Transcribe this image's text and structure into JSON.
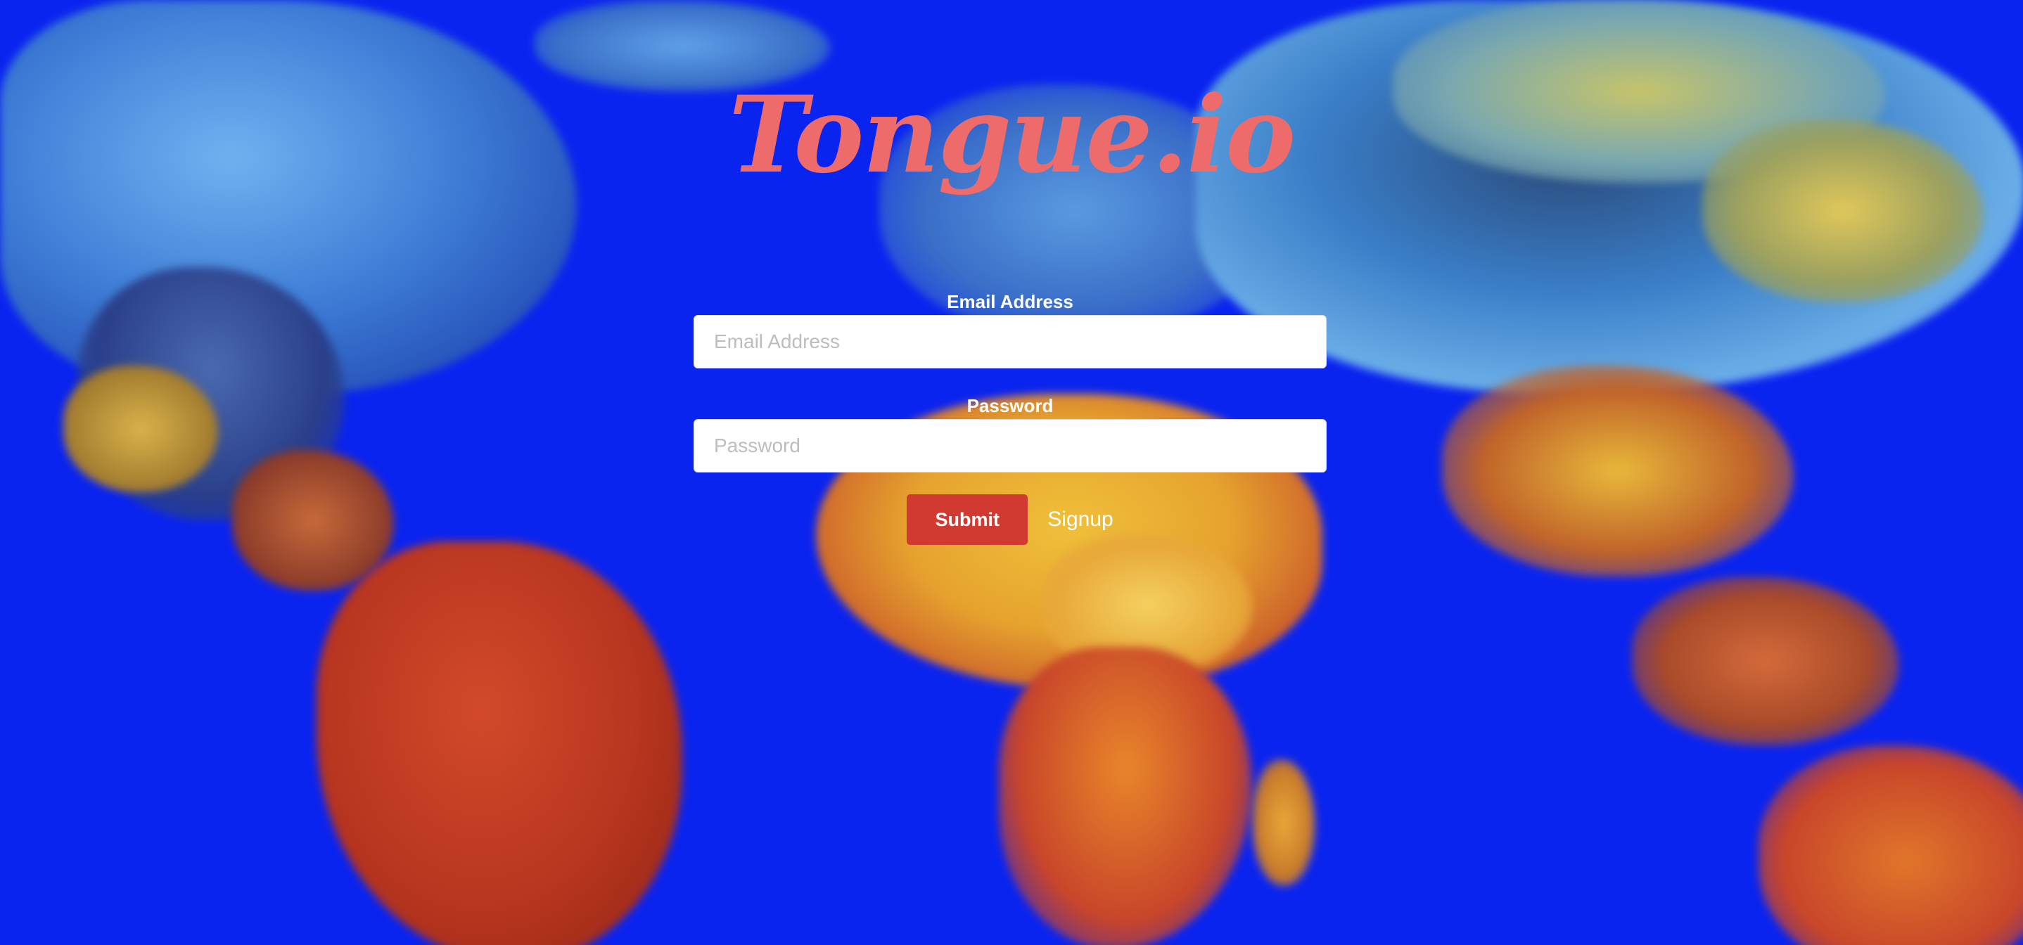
{
  "brand": {
    "logo_text": "Tongue.io",
    "logo_color": "#ee6b6b"
  },
  "login_form": {
    "email": {
      "label": "Email Address",
      "placeholder": "Email Address",
      "value": ""
    },
    "password": {
      "label": "Password",
      "placeholder": "Password",
      "value": ""
    },
    "submit_label": "Submit",
    "signup_label": "Signup"
  },
  "colors": {
    "background": "#0a24f0",
    "submit_button": "#d13a30",
    "label_text": "#ffffff"
  },
  "background_image": "painted-world-map"
}
